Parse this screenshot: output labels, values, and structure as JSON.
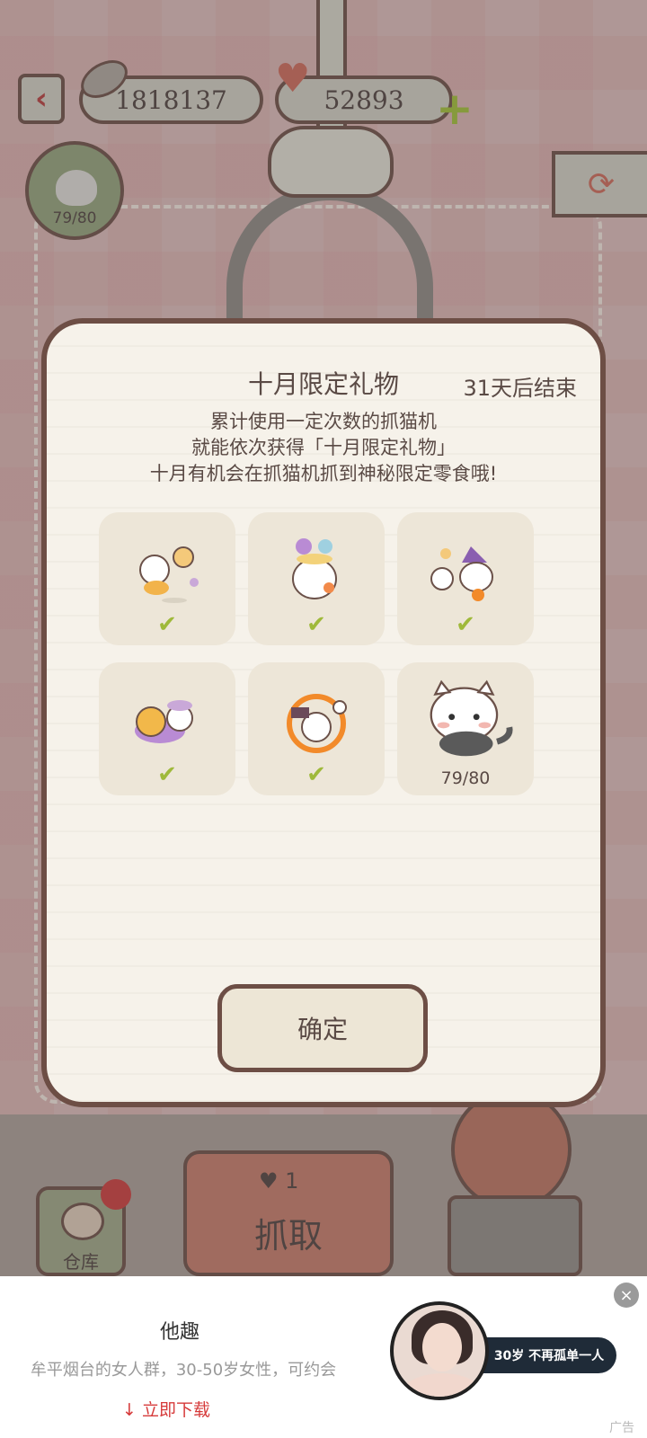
{
  "header": {
    "fish_count": "1818137",
    "heart_count": "52893",
    "cat_progress": "79/80",
    "icons": [
      "back-arrow-icon",
      "fish-icon",
      "heart-icon",
      "plus-icon",
      "refresh-icon"
    ]
  },
  "modal": {
    "title": "十月限定礼物",
    "deadline": "31天后结束",
    "description_lines": [
      "累计使用一定次数的抓猫机",
      "就能依次获得「十月限定礼物」",
      "十月有机会在抓猫机抓到神秘限定零食哦!"
    ],
    "gifts": [
      {
        "status": "collected",
        "mark": "✔"
      },
      {
        "status": "collected",
        "mark": "✔"
      },
      {
        "status": "collected",
        "mark": "✔"
      },
      {
        "status": "collected",
        "mark": "✔"
      },
      {
        "status": "collected",
        "mark": "✔"
      },
      {
        "status": "in-progress",
        "progress": "79/80",
        "progress_value": 0.9875
      }
    ],
    "confirm_label": "确定"
  },
  "bottom_bar": {
    "grab_cost": "1",
    "grab_label": "抓取",
    "warehouse_label": "仓库"
  },
  "ad": {
    "title": "他趣",
    "description": "牟平烟台的女人群，30-50岁女性，可约会",
    "download_label": "立即下载",
    "download_icon": "↓",
    "tagline": "30岁 不再孤单一人",
    "close_icon": "×",
    "label": "广告"
  },
  "colors": {
    "modal_border": "#6d4e45",
    "check_green": "#9fb93a",
    "ad_link_red": "#d63a3a"
  }
}
